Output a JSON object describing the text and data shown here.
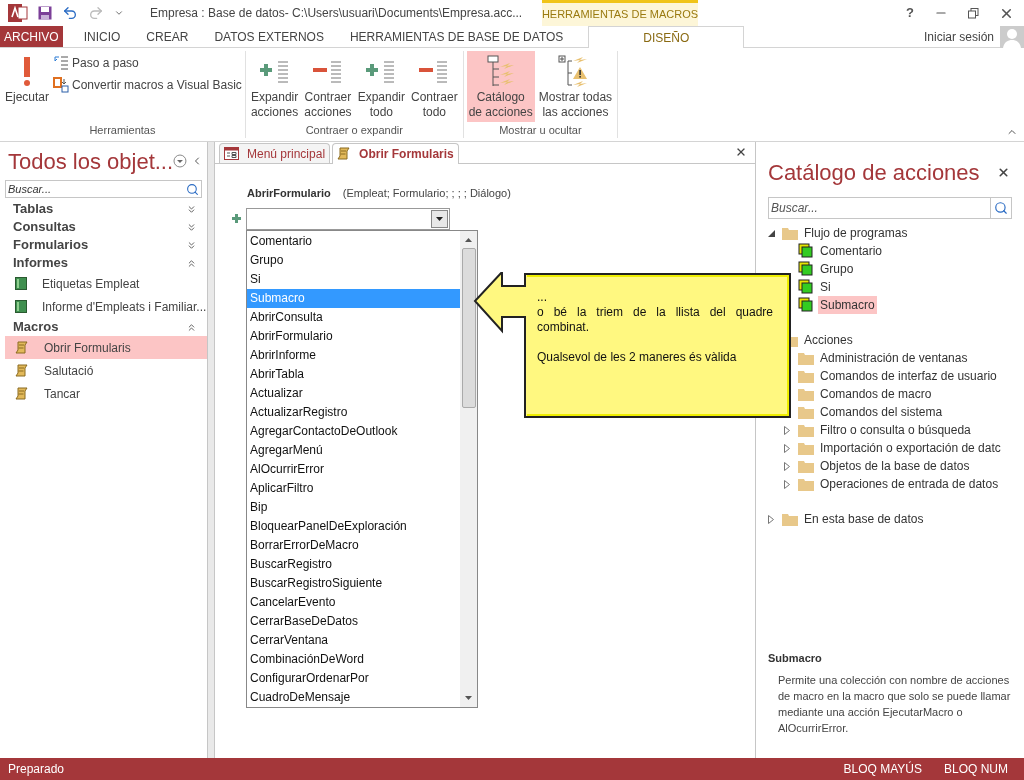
{
  "title_bar": {
    "title": "Empresa : Base de datos- C:\\Users\\usuari\\Documents\\Empresa.acc...",
    "contextual_tab": "HERRAMIENTAS DE MACROS",
    "help": "?",
    "sign_in": "Iniciar sesión"
  },
  "ribbon_tabs": [
    {
      "label": "ARCHIVO",
      "kind": "file",
      "selected": false
    },
    {
      "label": "INICIO",
      "kind": "normal",
      "selected": false
    },
    {
      "label": "CREAR",
      "kind": "normal",
      "selected": false
    },
    {
      "label": "DATOS EXTERNOS",
      "kind": "normal",
      "selected": false
    },
    {
      "label": "HERRAMIENTAS DE BASE DE DATOS",
      "kind": "normal",
      "selected": false
    },
    {
      "label": "DISEÑO",
      "kind": "contextual",
      "selected": true
    }
  ],
  "ribbon_groups": [
    {
      "label": "Herramientas",
      "buttons": [
        {
          "lines": [
            "Ejecutar"
          ],
          "kind": "run",
          "selected": false
        },
        {
          "label": "Paso a paso",
          "kind": "step",
          "selected": false
        },
        {
          "label": "Convertir macros a Visual Basic",
          "kind": "convert",
          "selected": false
        }
      ]
    },
    {
      "label": "Contraer o expandir",
      "buttons": [
        {
          "lines": [
            "Expandir",
            "acciones"
          ],
          "kind": "expand",
          "selected": false
        },
        {
          "lines": [
            "Contraer",
            "acciones"
          ],
          "kind": "collapse",
          "selected": false
        },
        {
          "lines": [
            "Expandir",
            "todo"
          ],
          "kind": "expand",
          "selected": false
        },
        {
          "lines": [
            "Contraer",
            "todo"
          ],
          "kind": "collapse",
          "selected": false
        }
      ]
    },
    {
      "label": "Mostrar u ocultar",
      "buttons": [
        {
          "lines": [
            "Catálogo",
            "de acciones"
          ],
          "kind": "catalog",
          "selected": true
        },
        {
          "lines": [
            "Mostrar todas",
            "las acciones"
          ],
          "kind": "show_all",
          "selected": false
        }
      ]
    }
  ],
  "nav": {
    "title": "Todos los objet...",
    "search_placeholder": "Buscar...",
    "groups": [
      {
        "label": "Tablas",
        "expanded": false
      },
      {
        "label": "Consultas",
        "expanded": false
      },
      {
        "label": "Formularios",
        "expanded": false
      },
      {
        "label": "Informes",
        "expanded": true,
        "items": [
          {
            "label": "Etiquetas Empleat",
            "kind": "report",
            "selected": false
          },
          {
            "label": "Informe d'Empleats i Familiar...",
            "kind": "report",
            "selected": false
          }
        ]
      },
      {
        "label": "Macros",
        "expanded": true,
        "items": [
          {
            "label": "Obrir Formularis",
            "kind": "macro",
            "selected": true
          },
          {
            "label": "Salutació",
            "kind": "macro",
            "selected": false
          },
          {
            "label": "Tancar",
            "kind": "macro",
            "selected": false
          }
        ]
      }
    ]
  },
  "document_tabs": [
    {
      "label": "Menú principal",
      "kind": "form",
      "selected": false
    },
    {
      "label": "Obrir Formularis",
      "kind": "macro",
      "selected": true
    }
  ],
  "macro": {
    "action": "AbrirFormulario",
    "arguments": "(Empleat; Formulario; ; ; ; Diálogo)",
    "dropdown_items": [
      {
        "label": "Comentario",
        "selected": false
      },
      {
        "label": "Grupo",
        "selected": false
      },
      {
        "label": "Si",
        "selected": false
      },
      {
        "label": "Submacro",
        "selected": true
      },
      {
        "label": "AbrirConsulta",
        "selected": false
      },
      {
        "label": "AbrirFormulario",
        "selected": false
      },
      {
        "label": "AbrirInforme",
        "selected": false
      },
      {
        "label": "AbrirTabla",
        "selected": false
      },
      {
        "label": "Actualizar",
        "selected": false
      },
      {
        "label": "ActualizarRegistro",
        "selected": false
      },
      {
        "label": "AgregarContactoDeOutlook",
        "selected": false
      },
      {
        "label": "AgregarMenú",
        "selected": false
      },
      {
        "label": "AlOcurrirError",
        "selected": false
      },
      {
        "label": "AplicarFiltro",
        "selected": false
      },
      {
        "label": "Bip",
        "selected": false
      },
      {
        "label": "BloquearPanelDeExploración",
        "selected": false
      },
      {
        "label": "BorrarErrorDeMacro",
        "selected": false
      },
      {
        "label": "BuscarRegistro",
        "selected": false
      },
      {
        "label": "BuscarRegistroSiguiente",
        "selected": false
      },
      {
        "label": "CancelarEvento",
        "selected": false
      },
      {
        "label": "CerrarBaseDeDatos",
        "selected": false
      },
      {
        "label": "CerrarVentana",
        "selected": false
      },
      {
        "label": "CombinaciónDeWord",
        "selected": false
      },
      {
        "label": "ConfigurarOrdenarPor",
        "selected": false
      },
      {
        "label": "CuadroDeMensaje",
        "selected": false
      }
    ]
  },
  "callout": {
    "paragraphs": [
      [
        "...",
        "o bé la triem de la llista del quadre combinat."
      ],
      [
        "Qualsevol de les 2 maneres és vàlida"
      ]
    ]
  },
  "catalog": {
    "title": "Catálogo de acciones",
    "search_placeholder": "Buscar...",
    "tree": [
      {
        "label": "Flujo de programas",
        "kind": "folder",
        "expanded": true,
        "children": [
          {
            "label": "Comentario",
            "kind": "action",
            "selected": false
          },
          {
            "label": "Grupo",
            "kind": "action",
            "selected": false
          },
          {
            "label": "Si",
            "kind": "action",
            "selected": false
          },
          {
            "label": "Submacro",
            "kind": "action",
            "selected": true
          }
        ]
      },
      {
        "label": "Acciones",
        "kind": "folder",
        "expanded": true,
        "children": [
          {
            "label": "Administración de ventanas",
            "kind": "folder",
            "expanded": false
          },
          {
            "label": "Comandos de interfaz de usuario",
            "kind": "folder",
            "expanded": false
          },
          {
            "label": "Comandos de macro",
            "kind": "folder",
            "expanded": false
          },
          {
            "label": "Comandos del sistema",
            "kind": "folder",
            "expanded": false
          },
          {
            "label": "Filtro o consulta o búsqueda",
            "kind": "folder",
            "expanded": false
          },
          {
            "label": "Importación o exportación de datc",
            "kind": "folder",
            "expanded": false
          },
          {
            "label": "Objetos de la base de datos",
            "kind": "folder",
            "expanded": false
          },
          {
            "label": "Operaciones de entrada de datos",
            "kind": "folder",
            "expanded": false
          }
        ]
      },
      {
        "label": "En esta base de datos",
        "kind": "folder",
        "expanded": false
      }
    ],
    "help_title": "Submacro",
    "help_text": "Permite una colección con nombre de acciones de macro en la macro que solo se puede llamar mediante una acción EjecutarMacro o AlOcurrirError."
  },
  "status_bar": {
    "text": "Preparado",
    "indicators": [
      "BLOQ MAYÚS",
      "BLOQ NUM"
    ]
  }
}
